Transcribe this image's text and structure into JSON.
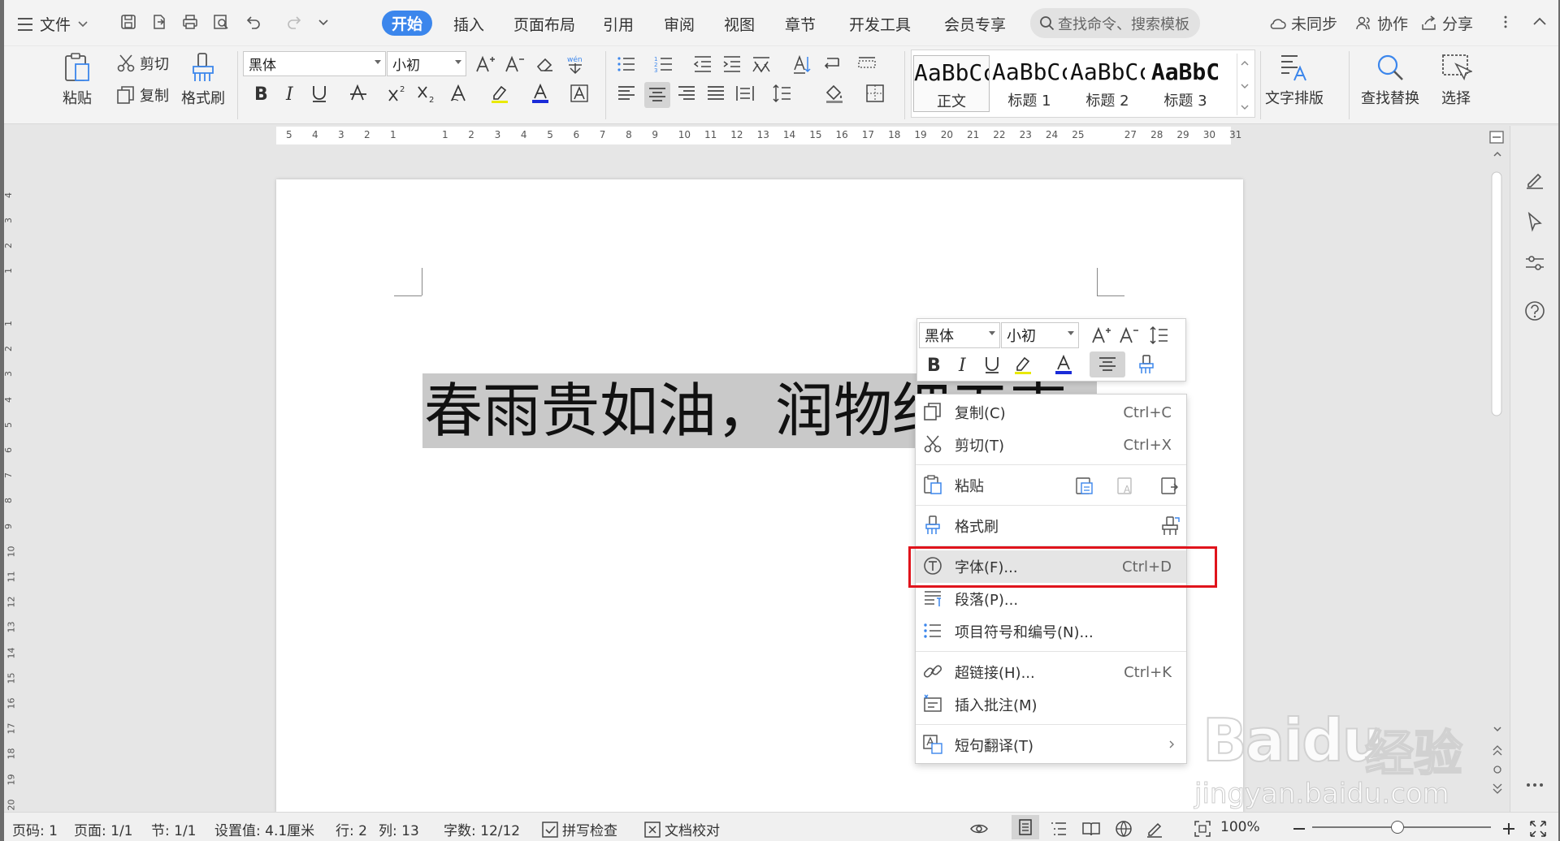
{
  "menubar": {
    "file_label": "文件",
    "tabs": [
      "开始",
      "插入",
      "页面布局",
      "引用",
      "审阅",
      "视图",
      "章节",
      "开发工具",
      "会员专享"
    ],
    "active_tab": "开始",
    "search_placeholder": "查找命令、搜索模板",
    "sync_label": "未同步",
    "collab_label": "协作",
    "share_label": "分享"
  },
  "ribbon": {
    "paste": "粘贴",
    "cut": "剪切",
    "copy": "复制",
    "format_painter": "格式刷",
    "font_name": "黑体",
    "font_size": "小初",
    "styles": [
      {
        "sample": "AaBbCcI",
        "label": "正文"
      },
      {
        "sample": "AaBbCc",
        "label": "标题 1"
      },
      {
        "sample": "AaBbCc",
        "label": "标题 2"
      },
      {
        "sample": "AaBbC",
        "label": "标题 3"
      }
    ],
    "text_layout": "文字排版",
    "find_replace": "查找替换",
    "select": "选择",
    "accent_color": "#3b86ec"
  },
  "ruler": {
    "h_left": [
      "5",
      "4",
      "3",
      "2",
      "1"
    ],
    "h_right": [
      "1",
      "2",
      "3",
      "4",
      "5",
      "6",
      "7",
      "8",
      "9",
      "10",
      "11",
      "12",
      "13",
      "14",
      "15",
      "16",
      "17",
      "18",
      "19",
      "20",
      "21",
      "22",
      "23",
      "24",
      "25",
      "27",
      "28",
      "29",
      "30",
      "31"
    ],
    "v_top": [
      "4",
      "3",
      "2",
      "1"
    ],
    "v_bottom": [
      "1",
      "2",
      "3",
      "4",
      "5",
      "6",
      "7",
      "8",
      "9",
      "10",
      "11",
      "12",
      "13",
      "14",
      "15",
      "16",
      "17",
      "18",
      "19",
      "20"
    ]
  },
  "document": {
    "selected_text": "春雨贵如油，润物细无声"
  },
  "mini_toolbar": {
    "font_name": "黑体",
    "font_size": "小初"
  },
  "context_menu": {
    "items": [
      {
        "label": "复制(C)",
        "shortcut": "Ctrl+C"
      },
      {
        "label": "剪切(T)",
        "shortcut": "Ctrl+X"
      },
      {
        "label": "粘贴",
        "shortcut": ""
      },
      {
        "label": "格式刷",
        "shortcut": ""
      },
      {
        "label": "字体(F)...",
        "shortcut": "Ctrl+D"
      },
      {
        "label": "段落(P)...",
        "shortcut": ""
      },
      {
        "label": "项目符号和编号(N)...",
        "shortcut": ""
      },
      {
        "label": "超链接(H)...",
        "shortcut": "Ctrl+K"
      },
      {
        "label": "插入批注(M)",
        "shortcut": ""
      },
      {
        "label": "短句翻译(T)",
        "shortcut": ""
      }
    ],
    "highlighted": "字体(F)...",
    "highlight_color": "#e0141c"
  },
  "status": {
    "page_no": "页码: 1",
    "pages": "页面: 1/1",
    "section": "节: 1/1",
    "setting": "设置值: 4.1厘米",
    "row": "行: 2",
    "col": "列: 13",
    "word_count": "字数: 12/12",
    "spell_check": "拼写检查",
    "doc_check": "文档校对",
    "zoom": "100%"
  },
  "watermark": {
    "brand": "Bai",
    "brand2": "du",
    "cn": "经验",
    "url": "jingyan.baidu.com"
  }
}
